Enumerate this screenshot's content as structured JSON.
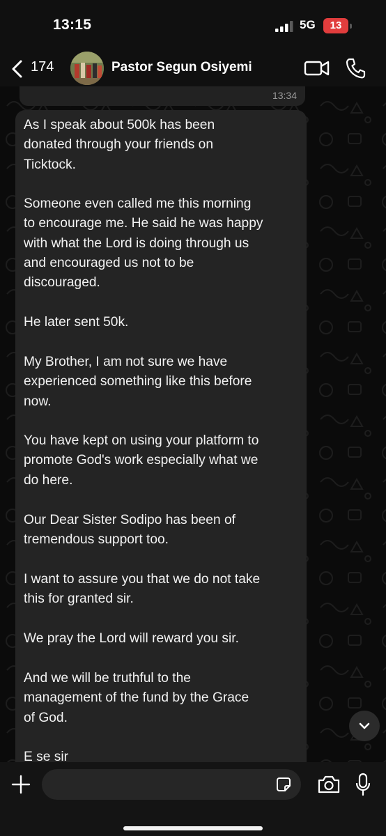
{
  "status_bar": {
    "time": "13:15",
    "network": "5G",
    "battery": "13"
  },
  "header": {
    "back_count": "174",
    "contact_name": "Pastor Segun Osiyemi"
  },
  "previous_message": {
    "time": "13:34"
  },
  "message": {
    "paragraphs": [
      "As I speak about 500k has been\ndonated through your friends on\nTicktock.",
      "Someone even called me this morning\nto encourage me. He said he was happy\nwith what the Lord is doing through us\nand encouraged us not to be\ndiscouraged.",
      "He later sent 50k.",
      "My Brother, I am not sure we have\nexperienced something like this before\nnow.",
      "You have kept on using your platform to\npromote God's work especially what we\ndo here.",
      "Our Dear Sister Sodipo has been of\ntremendous support too.",
      "I want to assure you that we do not take\nthis for granted sir.",
      "We pray the Lord will reward you sir.",
      "And we will be truthful to the\nmanagement of the fund by the Grace\nof God.",
      "E se sir"
    ]
  },
  "input": {
    "placeholder": "",
    "value": ""
  },
  "icons": {
    "back": "chevron-left-icon",
    "video": "video-camera-icon",
    "phone": "phone-icon",
    "attach": "plus-icon",
    "sticker": "sticker-icon",
    "camera": "camera-icon",
    "mic": "microphone-icon",
    "scroll": "chevron-down-icon"
  },
  "colors": {
    "background": "#0b0b0b",
    "bubble": "#242424",
    "battery": "#e13d3d",
    "text": "#f2f2f2",
    "timestamp": "#9a9a9a"
  }
}
